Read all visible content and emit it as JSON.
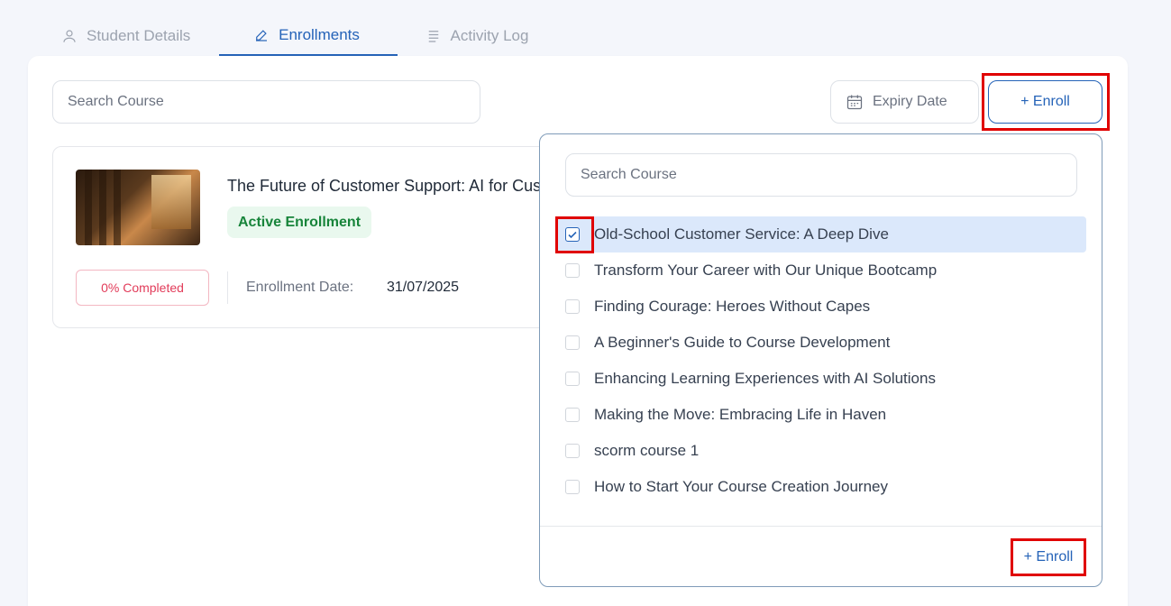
{
  "tabs": [
    {
      "label": "Student Details",
      "icon": "user-icon",
      "active": false
    },
    {
      "label": "Enrollments",
      "icon": "edit-icon",
      "active": true
    },
    {
      "label": "Activity Log",
      "icon": "list-icon",
      "active": false
    }
  ],
  "toolbar": {
    "search_placeholder": "Search Course",
    "expiry_label": "Expiry Date",
    "enroll_label": "+ Enroll"
  },
  "enrollment": {
    "title": "The Future of Customer Support: AI for Customer Service",
    "status": "Active Enrollment",
    "progress": "0% Completed",
    "date_label": "Enrollment Date:",
    "date_value": "31/07/2025"
  },
  "dropdown": {
    "search_placeholder": "Search Course",
    "options": [
      {
        "label": "Old-School Customer Service: A Deep Dive",
        "checked": true
      },
      {
        "label": "Transform Your Career with Our Unique Bootcamp",
        "checked": false
      },
      {
        "label": "Finding Courage: Heroes Without Capes",
        "checked": false
      },
      {
        "label": "A Beginner's Guide to Course Development",
        "checked": false
      },
      {
        "label": "Enhancing Learning Experiences with AI Solutions",
        "checked": false
      },
      {
        "label": "Making the Move: Embracing Life in Haven",
        "checked": false
      },
      {
        "label": "scorm course 1",
        "checked": false
      },
      {
        "label": "How to Start Your Course Creation Journey",
        "checked": false
      }
    ],
    "enroll_label": "+ Enroll"
  },
  "colors": {
    "accent": "#2563b8",
    "highlight": "#e00000",
    "success": "#17843a",
    "danger": "#e23c5a"
  }
}
